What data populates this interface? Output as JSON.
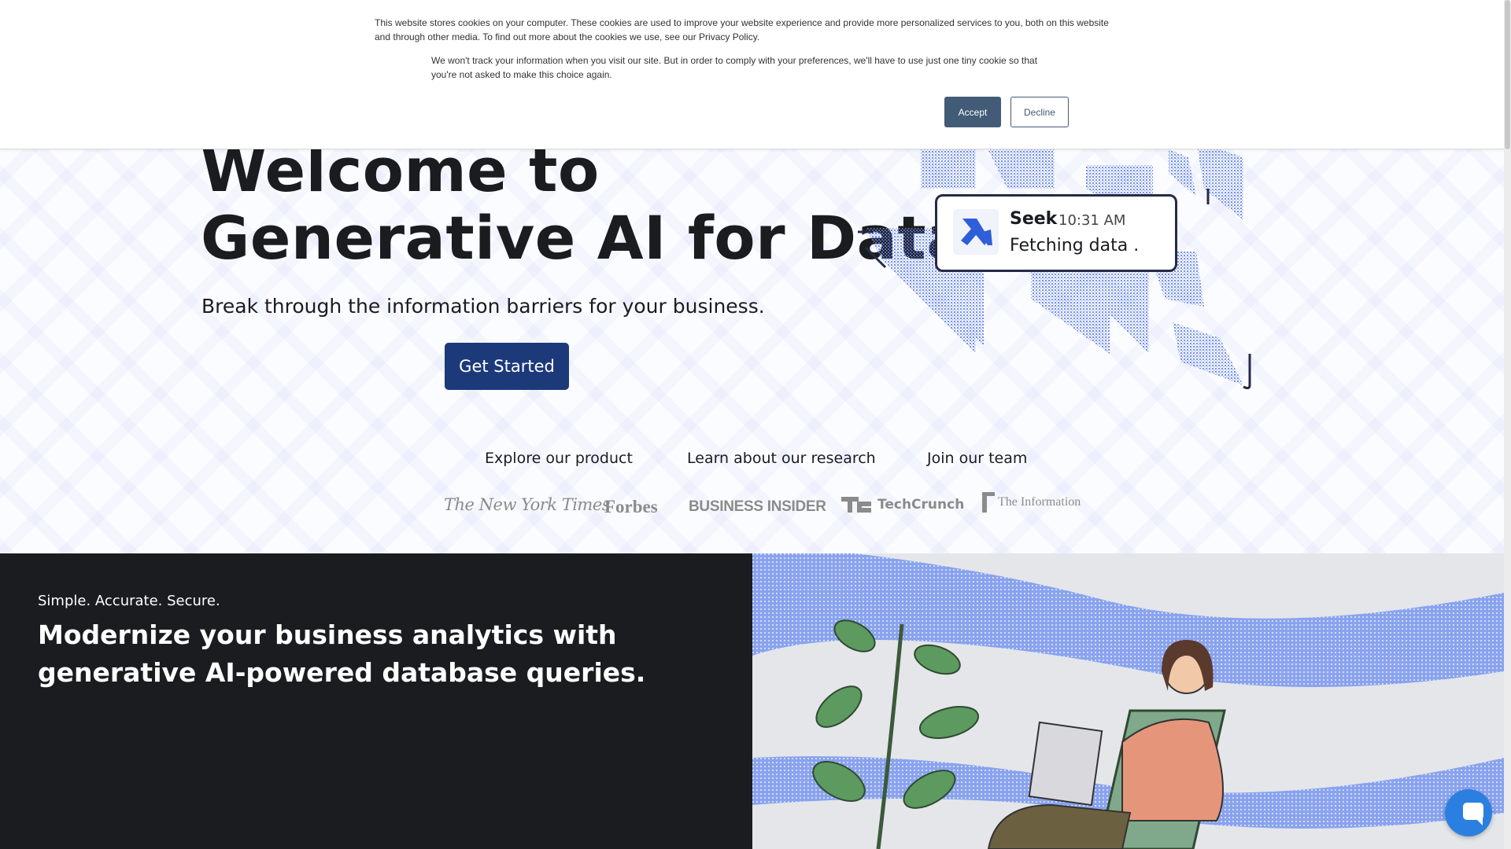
{
  "cookie_banner": {
    "text_primary": "This website stores cookies on your computer. These cookies are used to improve your website experience and provide more personalized services to you, both on this website and through other media. To find out more about the cookies we use, see our Privacy Policy.",
    "text_secondary": "We won't track your information when you visit our site. But in order to comply with your preferences, we'll have to use just one tiny cookie so that you're not asked to make this choice again.",
    "accept_label": "Accept",
    "decline_label": "Decline"
  },
  "hero": {
    "title_line1": "Welcome to",
    "title_line2": "Generative AI for Data",
    "subtitle": "Break through the information barriers for your business.",
    "cta_label": "Get Started",
    "links": [
      "Explore our product",
      "Learn about our research",
      "Join our team"
    ]
  },
  "press": {
    "logos": [
      "The New York Times",
      "Forbes",
      "BUSINESS INSIDER",
      "TechCrunch",
      "The Information"
    ]
  },
  "seek_card": {
    "name": "Seek",
    "time": "10:31 AM",
    "status": "Fetching data ."
  },
  "feature": {
    "kicker": "Simple. Accurate. Secure.",
    "headline": "Modernize your business analytics with generative AI-powered database queries."
  },
  "icons": {
    "seek_logo": "seek-logo-icon",
    "chat": "chat-bubble-icon"
  },
  "colors": {
    "cta": "#1c3a7a",
    "accept": "#425b76",
    "dark_section": "#1b1c20",
    "accent_blue": "#5b7ce8",
    "chat_widget": "#2b7fe0"
  }
}
